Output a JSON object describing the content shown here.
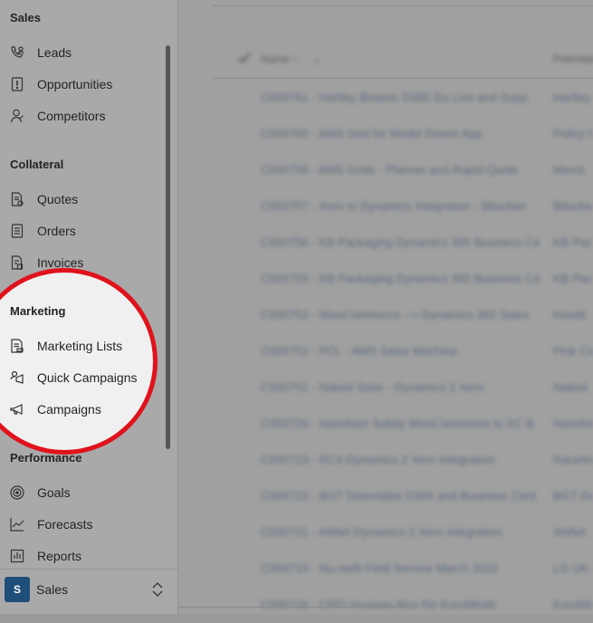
{
  "sidebar": {
    "sections": [
      {
        "title": "Sales",
        "items": [
          {
            "label": "Leads",
            "icon": "phone-person-icon"
          },
          {
            "label": "Opportunities",
            "icon": "exclamation-doc-icon"
          },
          {
            "label": "Competitors",
            "icon": "person-icon"
          }
        ]
      },
      {
        "title": "Collateral",
        "items": [
          {
            "label": "Quotes",
            "icon": "quote-doc-icon"
          },
          {
            "label": "Orders",
            "icon": "order-doc-icon"
          },
          {
            "label": "Invoices",
            "icon": "invoice-doc-icon"
          }
        ]
      },
      {
        "title": "Marketing",
        "items": [
          {
            "label": "Marketing Lists",
            "icon": "marketing-list-icon"
          },
          {
            "label": "Quick Campaigns",
            "icon": "quick-campaign-icon"
          },
          {
            "label": "Campaigns",
            "icon": "megaphone-icon"
          }
        ]
      },
      {
        "title": "Performance",
        "items": [
          {
            "label": "Goals",
            "icon": "target-icon"
          },
          {
            "label": "Forecasts",
            "icon": "trend-chart-icon"
          },
          {
            "label": "Reports",
            "icon": "report-icon"
          }
        ]
      }
    ],
    "app_switcher": {
      "badge": "S",
      "name": "Sales"
    }
  },
  "grid": {
    "headers": {
      "name": "Name ↑",
      "second": "Potential"
    },
    "rows": [
      {
        "name": "C000761 - Hartley Botanic D365 Go Live and Supp",
        "second": "Hartley"
      },
      {
        "name": "C000760 - AMS Grid for Model Driven App",
        "second": "Policy G"
      },
      {
        "name": "C000759 - AMS Grids - Planner and Rapid Quote",
        "second": "Merck"
      },
      {
        "name": "C000757 - Xero to Dynamics Integration - Bitucken",
        "second": "Bitucken"
      },
      {
        "name": "C000756 - KB Packaging Dynamics 365 Business Ce",
        "second": "KB Pack"
      },
      {
        "name": "C000755 - KB Packaging Dynamics 365 Business Ce",
        "second": "KB Pack"
      },
      {
        "name": "C000753 - WooCommerce --> Dynamics 365 Sales",
        "second": "Hewitt"
      },
      {
        "name": "C000752 - PCL - AMS Sales Machine",
        "second": "Pink Ca"
      },
      {
        "name": "C000751 - Naked Solar - Dynamics 2 Xero",
        "second": "Naked"
      },
      {
        "name": "C000724 - Hassham Safety WooCommerce to XC B",
        "second": "Hassham"
      },
      {
        "name": "C000723 - RCA Dynamics 2 Xero Integration",
        "second": "Racehor"
      },
      {
        "name": "C000722 - BGT Detectable D365 and Business Cent",
        "second": "BGT Det"
      },
      {
        "name": "C000721 - ANNA Dynamics 2 Xero Integration",
        "second": "ANNA"
      },
      {
        "name": "C000719 - Nu-swift Field Service March 2022",
        "second": "LG UK F"
      },
      {
        "name": "C000716 - CRFI Invoices Also Re-Euroblinds",
        "second": "Euroblin"
      }
    ]
  }
}
